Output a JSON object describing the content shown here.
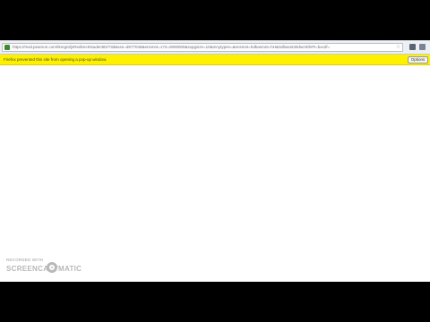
{
  "browser": {
    "url": "https://mail.pearson.com/tkmgnt/jsRedirect/studentID/?3d&ssn=d977049&ensmnt=1?2=0000000&sxpgsize=10&mnytypes=&ensmnt=hdbasmnt=hH&Sdbasst30dse!2th##=bxx2f=",
    "site_icon": "lock-icon",
    "bookmark_icon": "star-icon",
    "toolbar_icons": [
      "addon-icon",
      "menu-icon"
    ]
  },
  "notification": {
    "message": "Firefox prevented this site from opening a pop-up window.",
    "options_label": "Options"
  },
  "watermark": {
    "recorded_with": "RECORDED WITH",
    "brand_part1": "SCREENCAST",
    "brand_part2": "MATIC",
    "logo_icon": "screencast-o-matic-logo"
  },
  "colors": {
    "notification_bar": "#fdf100",
    "letterbox": "#000000"
  }
}
